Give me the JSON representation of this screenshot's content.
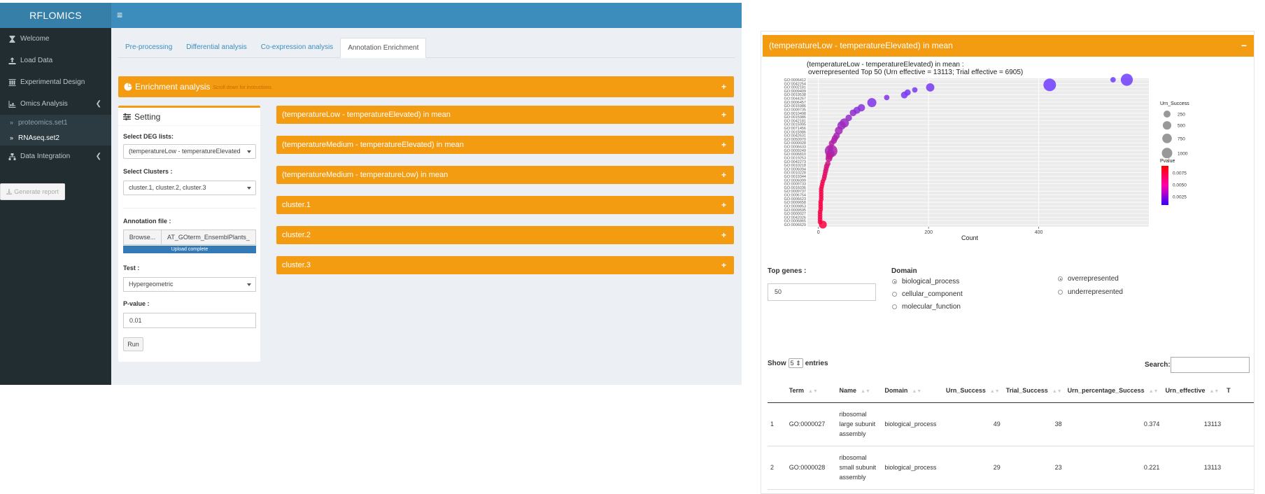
{
  "app": {
    "logo": "RFLOMICS",
    "sidebar": {
      "items": [
        {
          "label": "Welcome",
          "icon": "hourglass-icon"
        },
        {
          "label": "Load Data",
          "icon": "upload-icon"
        },
        {
          "label": "Experimental Design",
          "icon": "columns-icon"
        },
        {
          "label": "Omics Analysis",
          "icon": "chart-icon"
        },
        {
          "label": "proteomics.set1"
        },
        {
          "label": "RNAseq.set2"
        },
        {
          "label": "Data Integration",
          "icon": "sitemap-icon"
        }
      ],
      "generate_report": "Generate report"
    },
    "tabs": [
      "Pre-processing",
      "Differential analysis",
      "Co-expression analysis",
      "Annotation Enrichment"
    ],
    "enrichment": {
      "title": "Enrichment analysis",
      "hint": "Scroll down for instructions"
    },
    "setting": {
      "title": "Setting",
      "deg_label": "Select DEG lists:",
      "deg_value": "(temperatureLow - temperatureElevated",
      "clusters_label": "Select Clusters :",
      "clusters_value": "cluster.1, cluster.2, cluster.3",
      "annotation_label": "Annotation file :",
      "browse": "Browse...",
      "file_name": "AT_GOterm_EnsemblPlants_",
      "upload_status": "Upload complete",
      "test_label": "Test :",
      "test_value": "Hypergeometric",
      "pvalue_label": "P-value :",
      "pvalue_value": "0.01",
      "run": "Run"
    },
    "contrasts": [
      "(temperatureLow - temperatureElevated) in mean",
      "(temperatureMedium - temperatureElevated) in mean",
      "(temperatureMedium - temperatureLow) in mean",
      "cluster.1",
      "cluster.2",
      "cluster.3"
    ]
  },
  "panel": {
    "header": "(temperatureLow - temperatureElevated) in mean",
    "top_genes_label": "Top genes :",
    "top_genes_value": "50",
    "domain_label": "Domain",
    "domain_options": [
      "biological_process",
      "cellular_component",
      "molecular_function"
    ],
    "domain_selected": "biological_process",
    "representation_options": [
      "overrepresented",
      "underrepresented"
    ],
    "representation_selected": "overrepresented",
    "show_label": "Show",
    "show_value": "5",
    "entries_label": "entries",
    "search_label": "Search:",
    "table": {
      "headers": [
        "",
        "Term",
        "Name",
        "Domain",
        "Urn_Success",
        "Trial_Success",
        "Urn_percentage_Success",
        "Urn_effective",
        "T"
      ],
      "rows": [
        [
          "1",
          "GO:0000027",
          "ribosomal large subunit assembly",
          "biological_process",
          "49",
          "38",
          "0.374",
          "13113"
        ],
        [
          "2",
          "GO:0000028",
          "ribosomal small subunit assembly",
          "biological_process",
          "29",
          "23",
          "0.221",
          "13113"
        ]
      ]
    }
  },
  "chart_data": {
    "type": "scatter",
    "title": "(temperatureLow - temperatureElevated) in mean :",
    "subtitle": "overrepresented Top 50 (Urn effective = 13113; Trial effective = 6905)",
    "xlabel": "Count",
    "ylabel": "",
    "xlim": [
      -20,
      600
    ],
    "x_ticks": [
      0,
      200,
      400
    ],
    "y_tick_labels": [
      "GO:0006412",
      "GO:0042254",
      "GO:0002181",
      "GO:0009409",
      "GO:0019538",
      "GO:0044267",
      "GO:0006457",
      "GO:0015986",
      "GO:0009735",
      "GO:0010498",
      "GO:0015986",
      "GO:0042181",
      "GO:0015995",
      "GO:0071456",
      "GO:0015986",
      "GO:0042631",
      "GO:0050970",
      "GO:0000028",
      "GO:0006633",
      "GO:0009249",
      "GO:0006810",
      "GO:0019253",
      "GO:0042273",
      "GO:0010218",
      "GO:0006094",
      "GO:0010228",
      "GO:0019344",
      "GO:0006099",
      "GO:0009733",
      "GO:0016036",
      "GO:0009737",
      "GO:0006754",
      "GO:0006623",
      "GO:0009658",
      "GO:0009853",
      "GO:0009595",
      "GO:0000027",
      "GO:0042026",
      "GO:0006865",
      "GO:0006629"
    ],
    "points_count_rank": [
      {
        "count": 560,
        "rank": 0,
        "urn": 900,
        "pvalue": 0.002
      },
      {
        "count": 535,
        "rank": 0,
        "urn": 100,
        "pvalue": 0.002
      },
      {
        "count": 420,
        "rank": 2,
        "urn": 1000,
        "pvalue": 0.002
      },
      {
        "count": 203,
        "rank": 3,
        "urn": 350,
        "pvalue": 0.0025
      },
      {
        "count": 175,
        "rank": 4,
        "urn": 100,
        "pvalue": 0.0025
      },
      {
        "count": 162,
        "rank": 5,
        "urn": 150,
        "pvalue": 0.0025
      },
      {
        "count": 156,
        "rank": 6,
        "urn": 200,
        "pvalue": 0.0025
      },
      {
        "count": 124,
        "rank": 7,
        "urn": 100,
        "pvalue": 0.003
      },
      {
        "count": 97,
        "rank": 9,
        "urn": 450,
        "pvalue": 0.003
      },
      {
        "count": 78,
        "rank": 11,
        "urn": 250,
        "pvalue": 0.0035
      },
      {
        "count": 70,
        "rank": 12,
        "urn": 220,
        "pvalue": 0.0035
      },
      {
        "count": 63,
        "rank": 13,
        "urn": 200,
        "pvalue": 0.004
      },
      {
        "count": 55,
        "rank": 15,
        "urn": 180,
        "pvalue": 0.004
      },
      {
        "count": 47,
        "rank": 17,
        "urn": 450,
        "pvalue": 0.0045
      },
      {
        "count": 42,
        "rank": 18,
        "urn": 350,
        "pvalue": 0.0045
      },
      {
        "count": 37,
        "rank": 20,
        "urn": 300,
        "pvalue": 0.005
      },
      {
        "count": 33,
        "rank": 22,
        "urn": 180,
        "pvalue": 0.005
      },
      {
        "count": 30,
        "rank": 23,
        "urn": 160,
        "pvalue": 0.0055
      },
      {
        "count": 28,
        "rank": 24,
        "urn": 140,
        "pvalue": 0.0055
      },
      {
        "count": 24,
        "rank": 25,
        "urn": 120,
        "pvalue": 0.006
      },
      {
        "count": 22,
        "rank": 27,
        "urn": 110,
        "pvalue": 0.006
      },
      {
        "count": 23,
        "rank": 28,
        "urn": 1000,
        "pvalue": 0.0055
      },
      {
        "count": 22,
        "rank": 29,
        "urn": 300,
        "pvalue": 0.0055
      },
      {
        "count": 20,
        "rank": 30,
        "urn": 250,
        "pvalue": 0.006
      },
      {
        "count": 19,
        "rank": 31,
        "urn": 200,
        "pvalue": 0.0065
      },
      {
        "count": 17,
        "rank": 33,
        "urn": 100,
        "pvalue": 0.007
      },
      {
        "count": 15,
        "rank": 34,
        "urn": 100,
        "pvalue": 0.0075
      },
      {
        "count": 14,
        "rank": 35,
        "urn": 80,
        "pvalue": 0.0075
      },
      {
        "count": 13,
        "rank": 36,
        "urn": 80,
        "pvalue": 0.008
      },
      {
        "count": 12,
        "rank": 37,
        "urn": 70,
        "pvalue": 0.008
      },
      {
        "count": 11,
        "rank": 38,
        "urn": 70,
        "pvalue": 0.0085
      },
      {
        "count": 10,
        "rank": 39,
        "urn": 60,
        "pvalue": 0.0085
      },
      {
        "count": 8,
        "rank": 40,
        "urn": 60,
        "pvalue": 0.009
      },
      {
        "count": 7,
        "rank": 41,
        "urn": 60,
        "pvalue": 0.009
      },
      {
        "count": 6,
        "rank": 42,
        "urn": 60,
        "pvalue": 0.0095
      },
      {
        "count": 5,
        "rank": 43,
        "urn": 60,
        "pvalue": 0.0095
      },
      {
        "count": 5,
        "rank": 44,
        "urn": 60,
        "pvalue": 0.0095
      },
      {
        "count": 5,
        "rank": 45,
        "urn": 60,
        "pvalue": 0.0095
      },
      {
        "count": 5,
        "rank": 46,
        "urn": 60,
        "pvalue": 0.0095
      },
      {
        "count": 5,
        "rank": 47,
        "urn": 60,
        "pvalue": 0.0095
      },
      {
        "count": 4,
        "rank": 48,
        "urn": 60,
        "pvalue": 0.0095
      },
      {
        "count": 4,
        "rank": 49,
        "urn": 60,
        "pvalue": 0.0095
      },
      {
        "count": 4,
        "rank": 50,
        "urn": 60,
        "pvalue": 0.0095
      },
      {
        "count": 4,
        "rank": 51,
        "urn": 60,
        "pvalue": 0.0095
      },
      {
        "count": 3,
        "rank": 52,
        "urn": 60,
        "pvalue": 0.0095
      },
      {
        "count": 3,
        "rank": 53,
        "urn": 60,
        "pvalue": 0.0095
      },
      {
        "count": 3,
        "rank": 54,
        "urn": 60,
        "pvalue": 0.0095
      },
      {
        "count": 3,
        "rank": 55,
        "urn": 60,
        "pvalue": 0.0095
      },
      {
        "count": 3,
        "rank": 56,
        "urn": 60,
        "pvalue": 0.0095
      },
      {
        "count": 8,
        "rank": 57,
        "urn": 300,
        "pvalue": 0.0098
      }
    ],
    "legend_size": {
      "title": "Urn_Success",
      "values": [
        "250",
        "500",
        "750",
        "1000"
      ]
    },
    "legend_color": {
      "title": "Pvalue",
      "values": [
        "0.0075",
        "0.0050",
        "0.0025"
      ],
      "low_color": "#0000ff",
      "high_color": "#ff0000"
    },
    "grid": true,
    "legend_position": "right"
  }
}
